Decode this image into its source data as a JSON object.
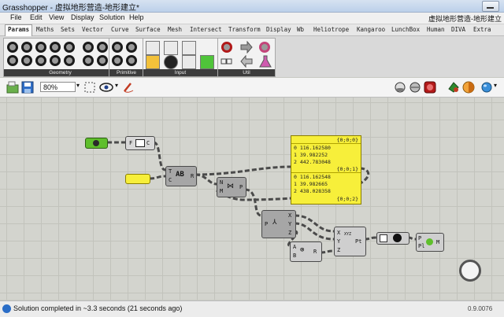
{
  "window": {
    "app_title": "Grasshopper - 虚拟地形营造-地形建立*"
  },
  "menu": {
    "items": [
      "File",
      "Edit",
      "View",
      "Display",
      "Solution",
      "Help"
    ],
    "document_title": "虚拟地形营造-地形建立"
  },
  "tabs": [
    "Params",
    "Maths",
    "Sets",
    "Vector",
    "Curve",
    "Surface",
    "Mesh",
    "Intersect",
    "Transform",
    "Display",
    "Wb",
    "Heliotrope",
    "Kangaroo",
    "LunchBox",
    "Human",
    "DIVA",
    "Extra"
  ],
  "ribbon": {
    "panels": [
      "Geometry",
      "Primitive",
      "Input",
      "Util"
    ]
  },
  "toolbar": {
    "zoom": "80%"
  },
  "canvas": {
    "nodes": {
      "file_path": {
        "label_f": "F",
        "label_c": "C"
      },
      "read_file": {
        "label_t": "T",
        "label_c": "C",
        "label_r": "R"
      },
      "cull": {
        "label_n": "N",
        "label_m": "M",
        "label_p": "P"
      },
      "decompose": {
        "label_p": "P",
        "label_x": "X",
        "label_y": "Y",
        "label_z": "Z"
      },
      "mult": {
        "label_a": "A",
        "label_b": "B",
        "label_r": "R"
      },
      "construct_pt": {
        "label_x": "X",
        "label_y": "Y",
        "label_z": "Z",
        "label_pt": "Pt",
        "badge": "XYZ"
      },
      "mesh": {
        "label_p": "P",
        "label_pi": "Pl",
        "label_m": "M"
      }
    },
    "panel": {
      "header_top": "{0;0;0}",
      "rows_a": [
        "0 116.162580",
        "1 39.982252",
        "2 442.783048"
      ],
      "header_mid": "{0;0;1}",
      "rows_b": [
        "0 116.162548",
        "1 39.982665",
        "2 438.028358"
      ],
      "header_bottom": "{0;0;2}"
    }
  },
  "status": {
    "message": "Solution completed in ~3.3 seconds (21 seconds ago)",
    "version": "0.9.0076"
  },
  "colors": {
    "accent_green": "#5fbf2c",
    "panel_yellow": "#f7ef3a"
  }
}
